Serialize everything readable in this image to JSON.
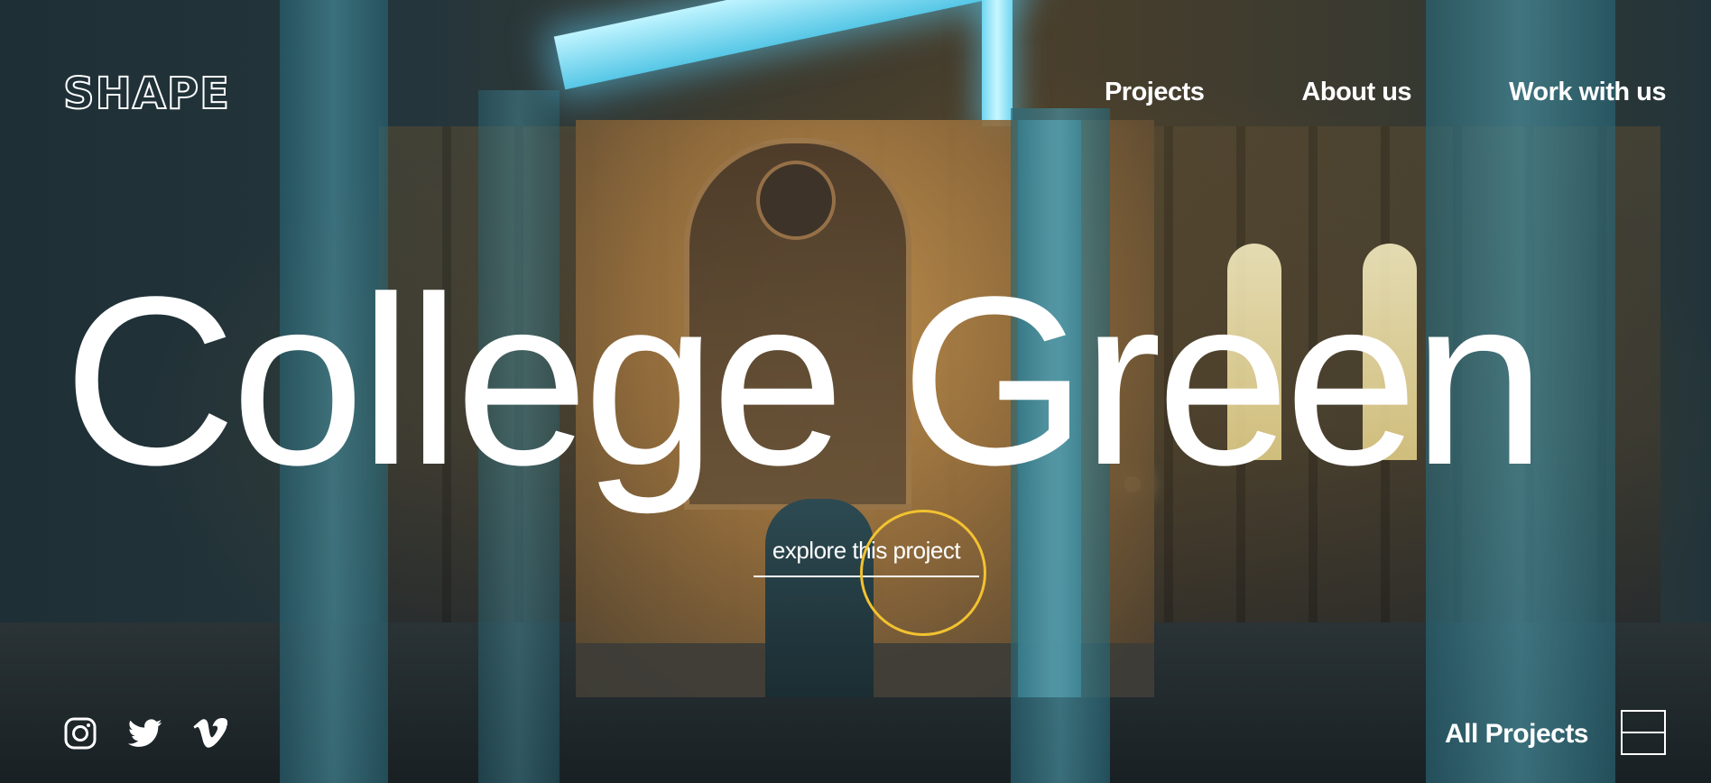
{
  "brand": {
    "logo_letters": [
      "S",
      "H",
      "A",
      "P",
      "E"
    ],
    "logo_name": "SHAPE"
  },
  "nav": {
    "items": [
      {
        "label": "Projects"
      },
      {
        "label": "About us"
      },
      {
        "label": "Work with us"
      }
    ]
  },
  "hero": {
    "title": "College Green",
    "cta_label": "explore this project"
  },
  "social": {
    "icons": [
      "instagram-icon",
      "twitter-icon",
      "vimeo-icon"
    ]
  },
  "footer": {
    "all_projects_label": "All Projects",
    "grid_toggle_icon": "grid-toggle-icon"
  },
  "colors": {
    "text": "#ffffff",
    "cursor_ring": "#f2c230",
    "pillar_teal": "#4fa3b5"
  }
}
